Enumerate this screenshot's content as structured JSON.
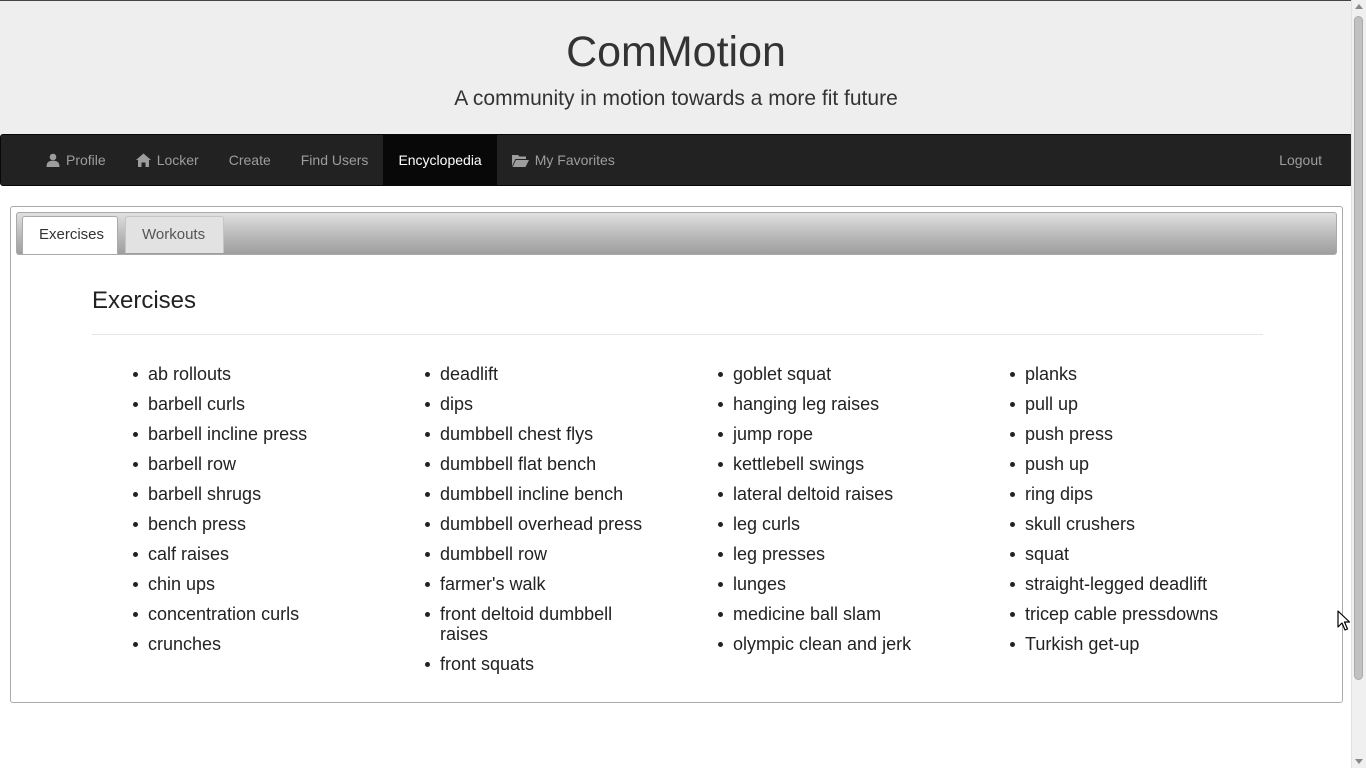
{
  "header": {
    "title": "ComMotion",
    "tagline": "A community in motion towards a more fit future"
  },
  "nav": {
    "items": [
      {
        "label": "Profile",
        "icon": "user-icon"
      },
      {
        "label": "Locker",
        "icon": "home-icon"
      },
      {
        "label": "Create",
        "icon": ""
      },
      {
        "label": "Find Users",
        "icon": ""
      },
      {
        "label": "Encyclopedia",
        "icon": "",
        "active": true
      },
      {
        "label": "My Favorites",
        "icon": "folder-open-icon"
      }
    ],
    "logout": "Logout"
  },
  "tabs": {
    "exercises": "Exercises",
    "workouts": "Workouts"
  },
  "content": {
    "title": "Exercises",
    "columns": [
      [
        "ab rollouts",
        "barbell curls",
        "barbell incline press",
        "barbell row",
        "barbell shrugs",
        "bench press",
        "calf raises",
        "chin ups",
        "concentration curls",
        "crunches"
      ],
      [
        "deadlift",
        "dips",
        "dumbbell chest flys",
        "dumbbell flat bench",
        "dumbbell incline bench",
        "dumbbell overhead press",
        "dumbbell row",
        "farmer's walk",
        "front deltoid dumbbell raises",
        "front squats"
      ],
      [
        "goblet squat",
        "hanging leg raises",
        "jump rope",
        "kettlebell swings",
        "lateral deltoid raises",
        "leg curls",
        "leg presses",
        "lunges",
        "medicine ball slam",
        "olympic clean and jerk"
      ],
      [
        "planks",
        "pull up",
        "push press",
        "push up",
        "ring dips",
        "skull crushers",
        "squat",
        "straight-legged deadlift",
        "tricep cable pressdowns",
        "Turkish get-up"
      ]
    ]
  },
  "colors": {
    "navbar_bg": "#222222",
    "navbar_active": "#080808",
    "nav_text": "#9d9d9d",
    "header_bg": "#eeeeee"
  }
}
